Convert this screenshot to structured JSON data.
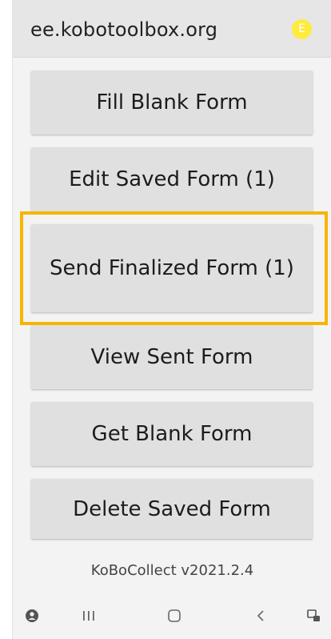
{
  "header": {
    "server_url": "ee.kobotoolbox.org",
    "avatar_letter": "E"
  },
  "menu": {
    "fill_blank_form": "Fill Blank Form",
    "edit_saved_form": "Edit Saved Form (1)",
    "send_finalized_form": "Send Finalized Form (1)",
    "view_sent_form": "View Sent Form",
    "get_blank_form": "Get Blank Form",
    "delete_saved_form": "Delete Saved Form"
  },
  "footer": {
    "version": "KoBoCollect v2021.2.4"
  },
  "navbar": {
    "icons": [
      "app-indicator-icon",
      "recent-apps-icon",
      "home-icon",
      "back-icon",
      "keyboard-icon"
    ]
  },
  "colors": {
    "highlight": "#f7b500",
    "avatar": "#ffeb3b",
    "button_bg": "#e0e0e0",
    "background": "#f3f3f3"
  }
}
